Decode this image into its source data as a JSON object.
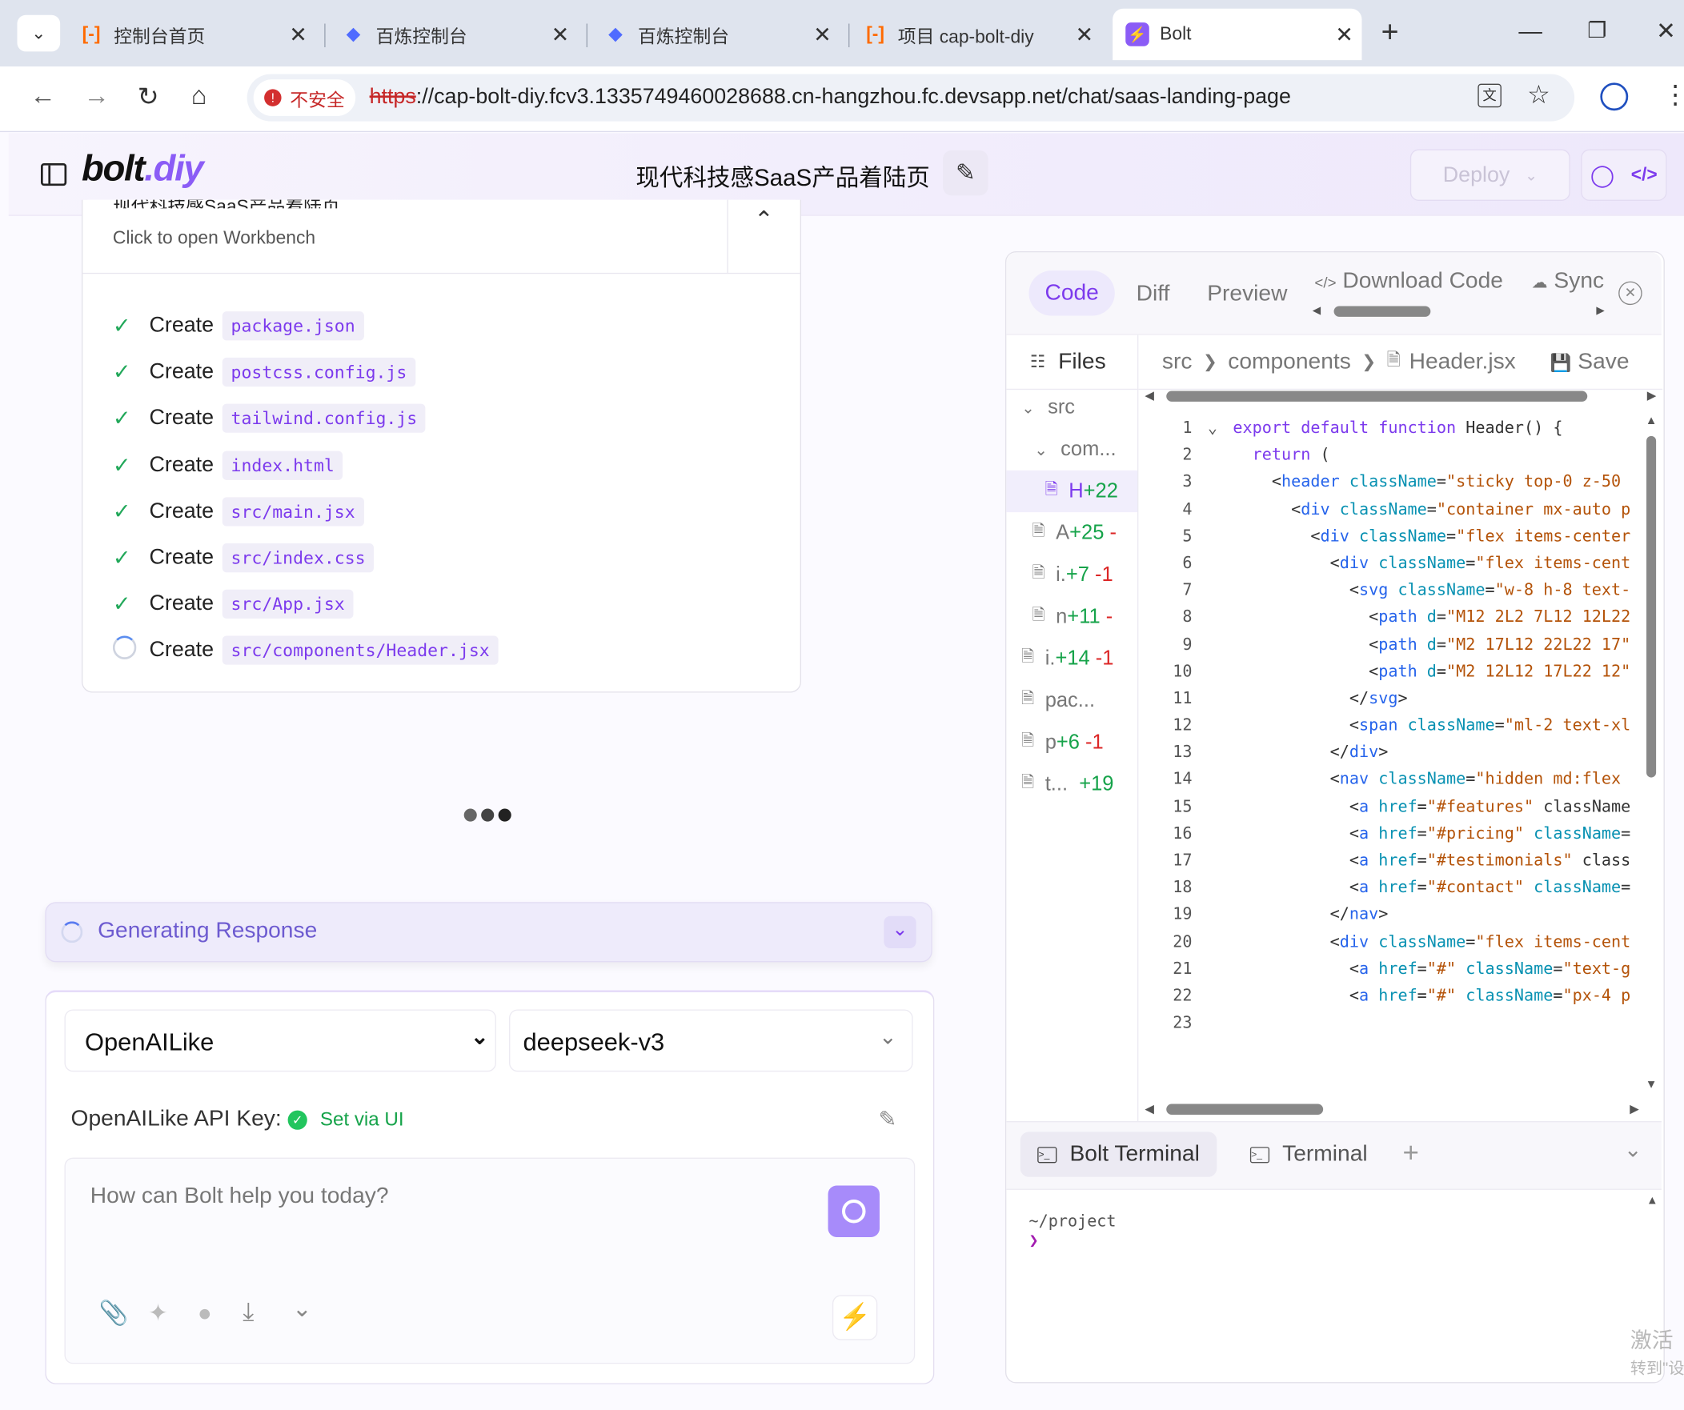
{
  "browser": {
    "tabs": [
      {
        "label": "控制台首页",
        "icon": "aliyun-icon"
      },
      {
        "label": "百炼控制台",
        "icon": "bailian-icon"
      },
      {
        "label": "百炼控制台",
        "icon": "bailian-icon"
      },
      {
        "label": "项目 cap-bolt-diy",
        "icon": "aliyun-icon"
      },
      {
        "label": "Bolt",
        "icon": "bolt-icon",
        "active": true
      }
    ],
    "new_tab": "+",
    "insecure_label": "不安全",
    "url_scheme": "https",
    "url_rest": "://cap-bolt-diy.fcv3.1335749460028688.cn-hangzhou.fc.devsapp.net/chat/saas-landing-page"
  },
  "app": {
    "logo_main": "bolt",
    "logo_suffix": ".diy",
    "chat_title": "现代科技感SaaS产品着陆页",
    "deploy_label": "Deploy"
  },
  "artifact": {
    "title_partial": "现代科技感SaaS产品着陆页",
    "subtitle": "Click to open Workbench",
    "actions": [
      {
        "verb": "Create",
        "file": "package.json",
        "status": "done"
      },
      {
        "verb": "Create",
        "file": "postcss.config.js",
        "status": "done"
      },
      {
        "verb": "Create",
        "file": "tailwind.config.js",
        "status": "done"
      },
      {
        "verb": "Create",
        "file": "index.html",
        "status": "done"
      },
      {
        "verb": "Create",
        "file": "src/main.jsx",
        "status": "done"
      },
      {
        "verb": "Create",
        "file": "src/index.css",
        "status": "done"
      },
      {
        "verb": "Create",
        "file": "src/App.jsx",
        "status": "done"
      },
      {
        "verb": "Create",
        "file": "src/components/Header.jsx",
        "status": "loading"
      }
    ]
  },
  "progress": {
    "label": "Generating Response"
  },
  "input": {
    "provider": "OpenAILike",
    "model": "deepseek-v3",
    "api_key_label": "OpenAILike API Key:",
    "api_key_status": "Set via UI",
    "placeholder": "How can Bolt help you today?"
  },
  "workbench": {
    "tabs": [
      "Code",
      "Diff",
      "Preview"
    ],
    "active_tab": "Code",
    "download_label": "Download Code",
    "sync_label": "Sync",
    "files_label": "Files",
    "breadcrumb": [
      "src",
      "components",
      "Header.jsx"
    ],
    "save_label": "Save",
    "tree": [
      {
        "name": "src",
        "kind": "folder",
        "indent": 0
      },
      {
        "name": "com...",
        "kind": "folder",
        "indent": 1
      },
      {
        "name": "H",
        "badge_add": "+22",
        "badge_del": "",
        "kind": "file",
        "indent": 2,
        "active": true
      },
      {
        "name": "A",
        "badge_add": "+25",
        "badge_del": "-",
        "kind": "file",
        "indent": 1
      },
      {
        "name": "i.",
        "badge_add": "+7",
        "badge_del": "-1",
        "kind": "file",
        "indent": 1
      },
      {
        "name": "n",
        "badge_add": "+11",
        "badge_del": "-",
        "kind": "file",
        "indent": 1
      },
      {
        "name": "i.",
        "badge_add": "+14",
        "badge_del": "-1",
        "kind": "file",
        "indent": 0
      },
      {
        "name": "pac...",
        "badge_add": "",
        "badge_del": "",
        "kind": "file",
        "indent": 0
      },
      {
        "name": "p",
        "badge_add": "+6",
        "badge_del": "-1",
        "kind": "file",
        "indent": 0
      },
      {
        "name": "t...",
        "badge_add": "+19",
        "badge_del": "",
        "kind": "file",
        "indent": 0
      }
    ],
    "code_lines": [
      "export default function Header() {",
      "  return (",
      "    <header className=\"sticky top-0 z-50",
      "      <div className=\"container mx-auto p",
      "        <div className=\"flex items-center",
      "          <div className=\"flex items-cent",
      "            <svg className=\"w-8 h-8 text-",
      "              <path d=\"M12 2L2 7L12 12L22",
      "              <path d=\"M2 17L12 22L22 17\"",
      "              <path d=\"M2 12L12 17L22 12\"",
      "            </svg>",
      "            <span className=\"ml-2 text-xl",
      "          </div>",
      "          <nav className=\"hidden md:flex",
      "            <a href=\"#features\" className",
      "            <a href=\"#pricing\" className=",
      "            <a href=\"#testimonials\" class",
      "            <a href=\"#contact\" className=",
      "          </nav>",
      "          <div className=\"flex items-cent",
      "            <a href=\"#\" className=\"text-g",
      "            <a href=\"#\" className=\"px-4 p",
      ""
    ],
    "terminal_tabs": [
      "Bolt Terminal",
      "Terminal"
    ],
    "terminal_add": "+",
    "terminal_path": "~/project",
    "terminal_prompt": "❯"
  },
  "watermark": {
    "line1": "激活",
    "line2": "转到\"设"
  }
}
